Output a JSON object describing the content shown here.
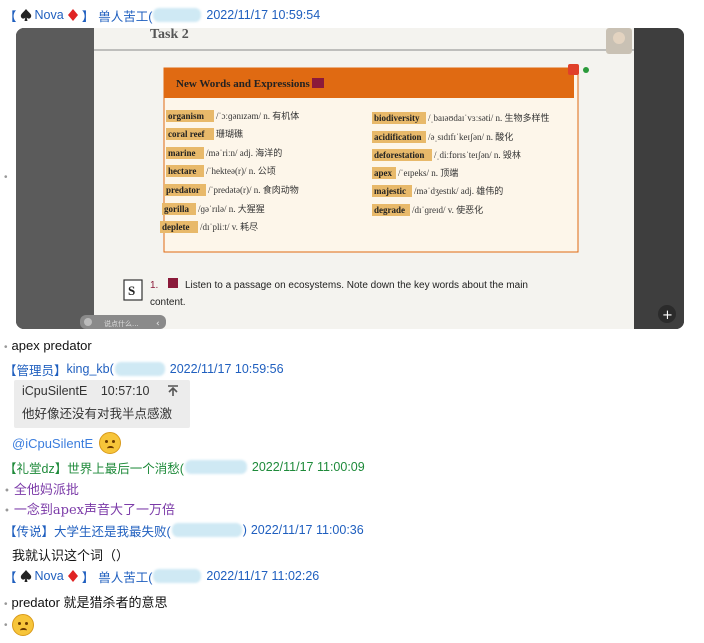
{
  "messages": {
    "m1": {
      "bracket_open": "【",
      "nick_text": "Nova",
      "bracket_close": "】",
      "name": "兽人苦工(",
      "time": "2022/11/17 10:59:54"
    },
    "m1_photo": {
      "task_title": "Task 2",
      "box_title": "New Words and Expressions",
      "left_words": [
        {
          "word": "organism",
          "def": "/ˈɔːɡənɪzəm/ n. 有机体"
        },
        {
          "word": "coral reef",
          "def": "珊瑚礁"
        },
        {
          "word": "marine",
          "def": "/məˈriːn/ adj. 海洋的"
        },
        {
          "word": "hectare",
          "def": "/ˈhekteə(r)/ n. 公顷"
        },
        {
          "word": "predator",
          "def": "/ˈpredətə(r)/ n. 食肉动物"
        },
        {
          "word": "gorilla",
          "def": "/ɡəˈrɪlə/ n. 大猩猩"
        },
        {
          "word": "deplete",
          "def": "/dɪˈpliːt/ v. 耗尽"
        }
      ],
      "right_words": [
        {
          "word": "biodiversity",
          "def": "/ˌbaɪəʊdaɪˈvɜːsəti/ n. 生物多样性"
        },
        {
          "word": "acidification",
          "def": "/əˌsɪdɪfɪˈkeɪʃən/ n. 酸化"
        },
        {
          "word": "deforestation",
          "def": "/ˌdiːfɒrɪsˈteɪʃən/ n. 毁林"
        },
        {
          "word": "apex",
          "def": "/ˈeɪpeks/ n. 顶端"
        },
        {
          "word": "majestic",
          "def": "/məˈdʒestɪk/ adj. 雄伟的"
        },
        {
          "word": "degrade",
          "def": "/dɪˈɡreɪd/ v. 使恶化"
        }
      ],
      "listen_num": "1.",
      "listen_text": "Listen to a passage on ecosystems. Note down the key words about the main",
      "listen_text2": "content.",
      "s_icon": "S",
      "chat_placeholder": "说点什么...",
      "zoom_plus": "+"
    },
    "m1_text": "apex predator",
    "m2": {
      "tag": "【管理员】",
      "name": "king_kb(",
      "time": "2022/11/17 10:59:56",
      "quote_author": "iCpuSilentE",
      "quote_time": "10:57:10",
      "quote_text": "他好像还没有对我半点感激",
      "mention": "@iCpuSilentE"
    },
    "m3": {
      "tag": "【礼堂dz】",
      "name": "世界上最后一个消愁(",
      "time": "2022/11/17 11:00:09",
      "line1": "全他妈派批",
      "line2": "一念到apex声音大了一万倍"
    },
    "m4": {
      "tag": "【传说】",
      "name": "大学生还是我最失败(",
      "close": ")",
      "time": "2022/11/17 11:00:36",
      "text": "我就认识这个词（）"
    },
    "m5": {
      "bracket_open": "【",
      "nick_text": "Nova",
      "bracket_close": "】",
      "name": "兽人苦工(",
      "time": "2022/11/17 11:02:26",
      "text": "predator 就是猎杀者的意思"
    }
  },
  "colors": {
    "blue_name": "#1f5fbf",
    "green_name": "#1e8a3a",
    "purple_text": "#7b3aa8",
    "orange_box": "#e06a12"
  },
  "icons": {
    "spade": "spade-icon",
    "diamond": "diamond-icon",
    "upload": "arrow-up-icon",
    "emoji": "dizzy-face-emoji-icon"
  }
}
